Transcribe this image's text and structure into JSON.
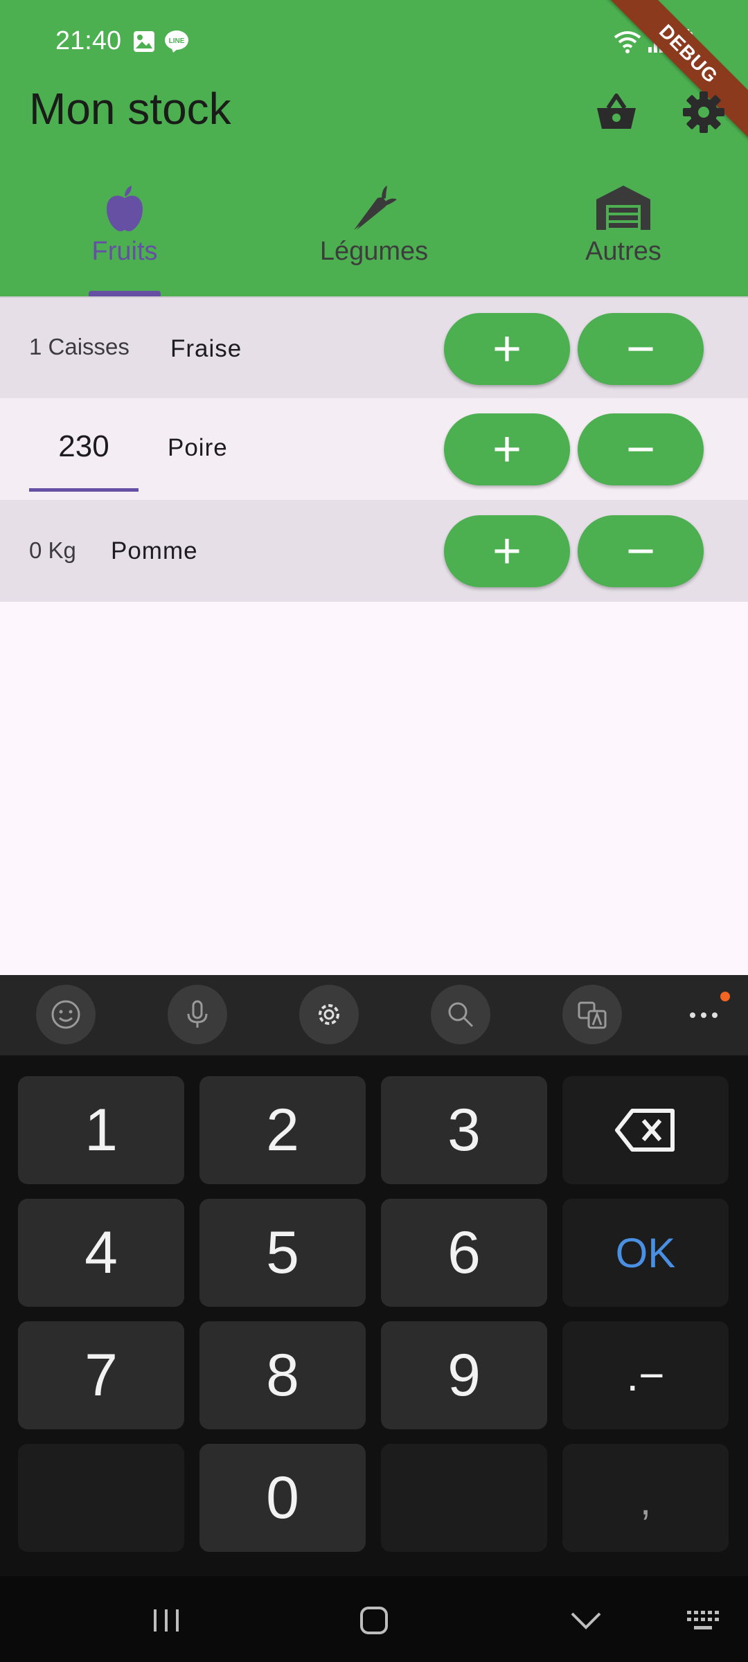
{
  "status_bar": {
    "time": "21:40"
  },
  "debug_banner": "DEBUG",
  "app_bar": {
    "title": "Mon stock"
  },
  "tabs": [
    {
      "label": "Fruits",
      "icon": "apple-icon",
      "selected": true
    },
    {
      "label": "Légumes",
      "icon": "carrot-icon",
      "selected": false
    },
    {
      "label": "Autres",
      "icon": "warehouse-icon",
      "selected": false
    }
  ],
  "items": [
    {
      "quantity": "1 Caisses",
      "name": "Fraise"
    },
    {
      "quantity_input": "230",
      "name": "Poire"
    },
    {
      "quantity": "0 Kg",
      "name": "Pomme"
    }
  ],
  "buttons": {
    "plus": "+",
    "minus": "−"
  },
  "keyboard": {
    "keys": [
      "1",
      "2",
      "3",
      "4",
      "5",
      "6",
      "7",
      "8",
      "9",
      "0"
    ],
    "ok": "OK",
    "dot_minus": ".−",
    "comma": ","
  },
  "colors": {
    "app_bar": "#4caf50",
    "accent": "#6650a4",
    "button": "#4caf50"
  }
}
